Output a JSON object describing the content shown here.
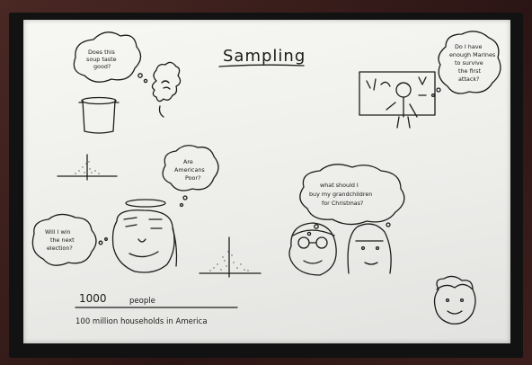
{
  "board": {
    "title": "Sampling",
    "bubbles": {
      "soup": [
        "Does this",
        "soup taste",
        "good?"
      ],
      "teacher": [
        "Do I have",
        "enough Marines",
        "to survive",
        "the first",
        "attack?"
      ],
      "americans": [
        "Are",
        "Americans",
        "Poor?"
      ],
      "election": [
        "Will I win",
        "the next",
        "election?"
      ],
      "christmas": [
        "what should I",
        "buy my grandchildren",
        "for Christmas?"
      ]
    },
    "footer": {
      "count": "1000",
      "count_unit": "people",
      "population": "100 million households in America"
    }
  }
}
